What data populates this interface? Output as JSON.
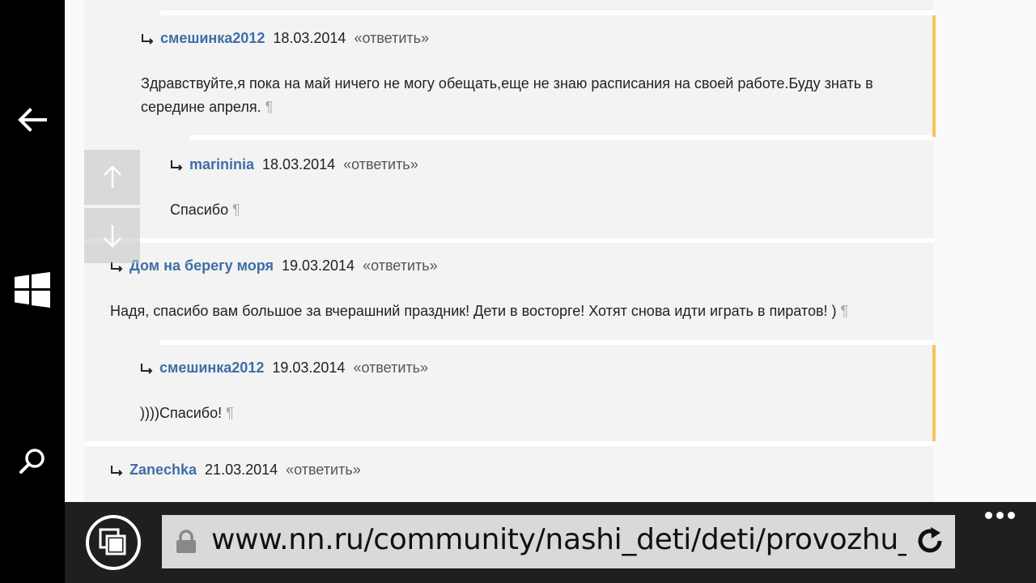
{
  "comments": [
    {
      "author": "смешинка2012",
      "date": "18.03.2014",
      "reply": "«ответить»",
      "text": "Здравствуйте,я пока на май ничего не могу обещать,еще не знаю расписания на своей работе.Буду знать в середине апреля.",
      "pilcrow": "¶"
    },
    {
      "author": "marininia",
      "date": "18.03.2014",
      "reply": "«ответить»",
      "text": "Спасибо",
      "pilcrow": "¶"
    },
    {
      "author": "Дом на берегу моря",
      "date": "19.03.2014",
      "reply": "«ответить»",
      "text": "Надя, спасибо вам большое за вчерашний праздник! Дети в восторге! Хотят снова идти играть в пиратов! )",
      "pilcrow": "¶"
    },
    {
      "author": "смешинка2012",
      "date": "19.03.2014",
      "reply": "«ответить»",
      "text": "))))Спасибо!",
      "pilcrow": "¶"
    },
    {
      "author": "Zanechka",
      "date": "21.03.2014",
      "reply": "«ответить»"
    }
  ],
  "browser": {
    "url": "www.nn.ru/community/nashi_deti/deti/provozhu_dni_ro"
  },
  "colors": {
    "author": "#3d6ea8",
    "highlight": "#f4c55a",
    "addressbar": "#1f1f1f"
  },
  "icons": {
    "back": "arrow-left",
    "windows": "windows-logo",
    "search": "magnifier",
    "tabs": "tabs",
    "lock": "lock",
    "refresh": "refresh",
    "more": "ellipsis",
    "scroll_up": "arrow-up",
    "scroll_down": "arrow-down",
    "reply": "reply-arrow"
  }
}
